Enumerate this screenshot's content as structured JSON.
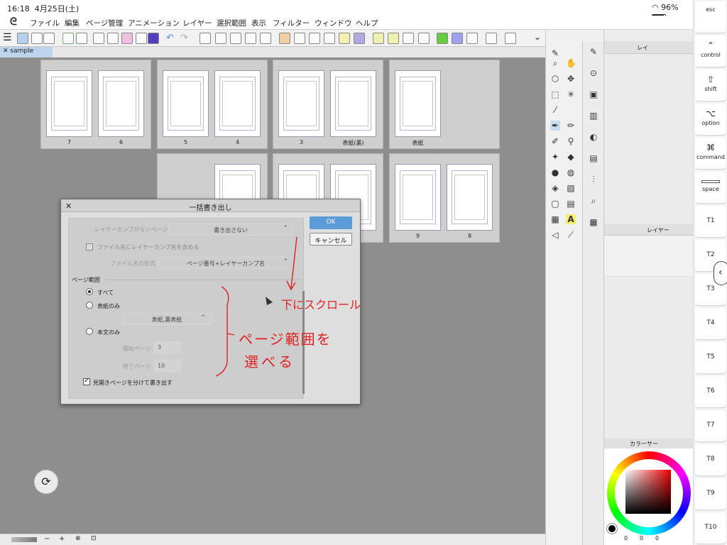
{
  "status": {
    "time": "16:18",
    "date": "4月25日(土)",
    "battery": "96%"
  },
  "menu": [
    "ファイル",
    "編集",
    "ページ管理",
    "アニメーション",
    "レイヤー",
    "選択範囲",
    "表示",
    "フィルター",
    "ウィンドウ",
    "ヘルプ"
  ],
  "tab": {
    "label": "sample"
  },
  "pages": {
    "row1": [
      "7",
      "6",
      "5",
      "4",
      "3",
      "表紙(裏)",
      "表紙"
    ],
    "row2": [
      "9",
      "8"
    ]
  },
  "dialog": {
    "title": "一括書き出し",
    "layer_comp_label": "レイヤーカンプがないページ",
    "layer_comp_value": "書き出さない",
    "include_comp_name": "ファイル名にレイヤーカンプ名を含める",
    "filename_format_label": "ファイル名の形式",
    "filename_format_value": "ページ番号+レイヤーカンプ名",
    "page_range_label": "ページ範囲",
    "opt_all": "すべて",
    "opt_cover": "表紙のみ",
    "cover_select": "表紙,裏表紙",
    "opt_body": "本文のみ",
    "start_label": "開始ページ",
    "start_value": "3",
    "end_label": "終了ページ",
    "end_value": "10",
    "split_spread": "見開きページを分けて書き出す",
    "ok": "OK",
    "cancel": "キャンセル"
  },
  "annotation": {
    "scroll_note": "下にスクロール",
    "range_note_1": "ページ範囲を",
    "range_note_2": "選べる",
    "color": "#e02020"
  },
  "panels": {
    "layer_tab": "レイヤー",
    "layer_tab_short": "レイ",
    "color_tab": "カラーサー"
  },
  "keys": [
    {
      "sym": "",
      "label": "esc"
    },
    {
      "sym": "⌃",
      "label": "control"
    },
    {
      "sym": "⇧",
      "label": "shift"
    },
    {
      "sym": "⌥",
      "label": "option"
    },
    {
      "sym": "⌘",
      "label": "command"
    },
    {
      "sym": "",
      "label": "space"
    },
    {
      "sym": "",
      "label": "T1"
    },
    {
      "sym": "",
      "label": "T2"
    },
    {
      "sym": "",
      "label": "T3"
    },
    {
      "sym": "",
      "label": "T4"
    },
    {
      "sym": "",
      "label": "T5"
    },
    {
      "sym": "",
      "label": "T6"
    },
    {
      "sym": "",
      "label": "T7"
    },
    {
      "sym": "",
      "label": "T8"
    },
    {
      "sym": "",
      "label": "T9"
    },
    {
      "sym": "",
      "label": "T10"
    }
  ],
  "colors": {
    "accent": "#5a9bd8",
    "annotation": "#e02020",
    "selected_color": "#d01818"
  },
  "bottom": {
    "minus": "−",
    "plus": "+",
    "color_values": [
      "0",
      "0",
      "0"
    ]
  }
}
